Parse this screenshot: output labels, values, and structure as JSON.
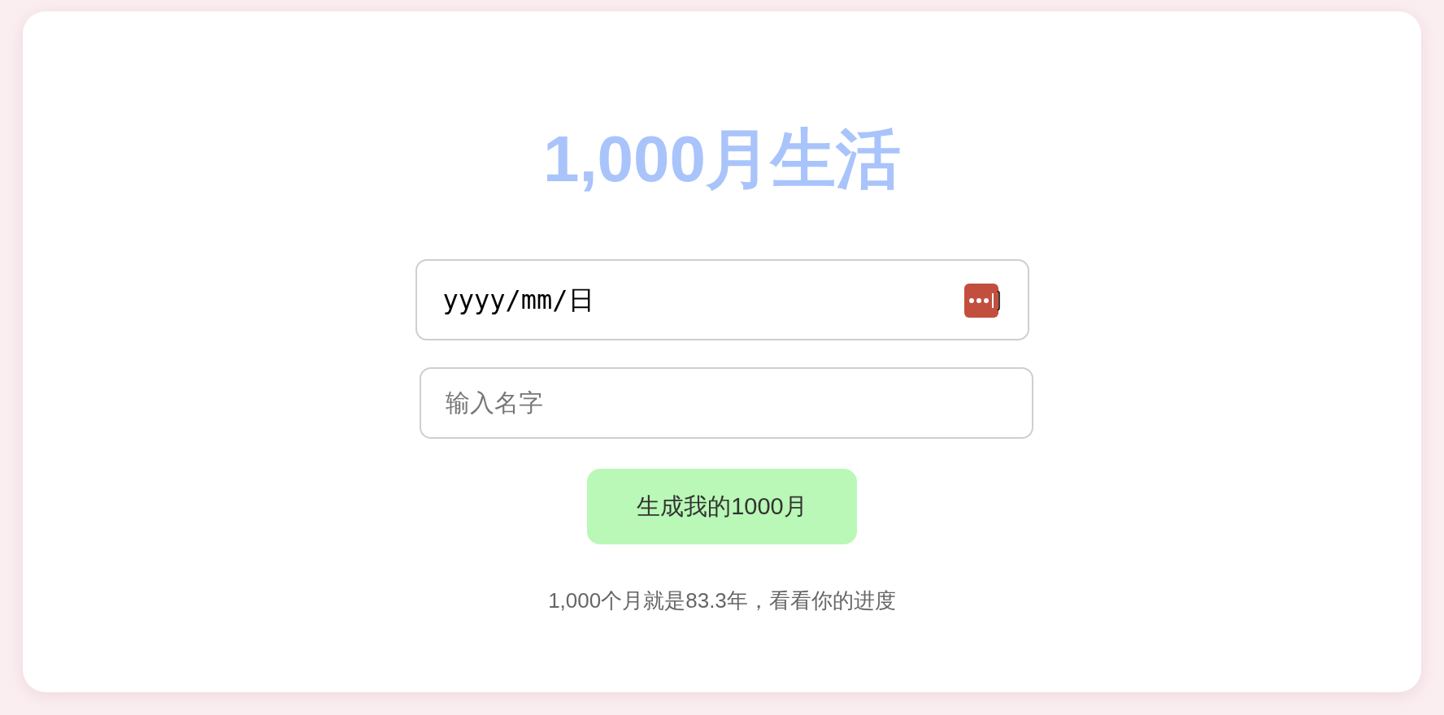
{
  "title": "1,000月生活",
  "date_field": {
    "placeholder": "yyyy/mm/日"
  },
  "name_field": {
    "placeholder": "输入名字"
  },
  "button": "生成我的1000月",
  "note": "1,000个月就是83.3年，看看你的进度"
}
